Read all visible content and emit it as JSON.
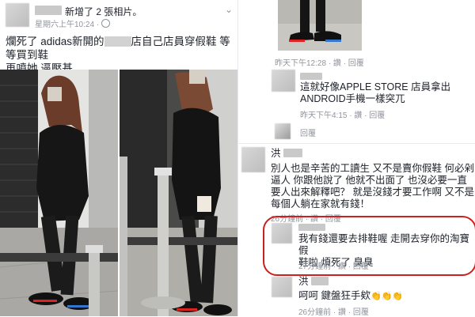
{
  "post": {
    "header_action": "新增了 2 張相片。",
    "timestamp": "星期六上午10:24",
    "privacy_symbol": "·",
    "body_part1": "爛死了 adidas新開的",
    "body_part2": "店自己店員穿假鞋 等等買到鞋",
    "body_line2": "再噴她 逼壓基"
  },
  "comments": [
    {
      "meta": "昨天下午12:28 · 讚 · 回覆"
    },
    {
      "text_line1": "這就好像APPLE STORE 店員拿出",
      "text_line2": "ANDROID手機一樣突兀",
      "meta": "昨天下午4:15 · 讚 · 回覆"
    },
    {
      "reply_label": "回覆"
    },
    {
      "name_prefix": "洪",
      "text_line1": "別人也是辛苦的工讀生 又不是賣你假鞋 何必剁",
      "text_line2": "逼人 你跟他說了 他就不出面了 也沒必要一直",
      "text_line3": "要人出來解釋吧？ 就是沒錢才要工作啊 又不是",
      "text_line4": "每個人躺在家就有錢！",
      "meta": "26分鐘前 · 讚 · 回覆"
    },
    {
      "text_line1": "我有錢還要去排鞋喔 走開去穿你的淘寶假",
      "text_line2": "鞋啦 煩死了 臭臭",
      "meta": "27分鐘前 · 讚 · 回覆"
    },
    {
      "name_prefix": "洪",
      "text": "呵呵 鍵盤狂手欸",
      "emojis": "👏👏👏",
      "meta": "26分鐘前 · 讚 · 回覆"
    }
  ],
  "colors": {
    "link_gray": "#90949c",
    "text": "#1d2129",
    "highlight_red": "#cc1f1f"
  },
  "icons": [
    "chevron-down-icon",
    "globe-icon",
    "clap-emoji-icon"
  ]
}
